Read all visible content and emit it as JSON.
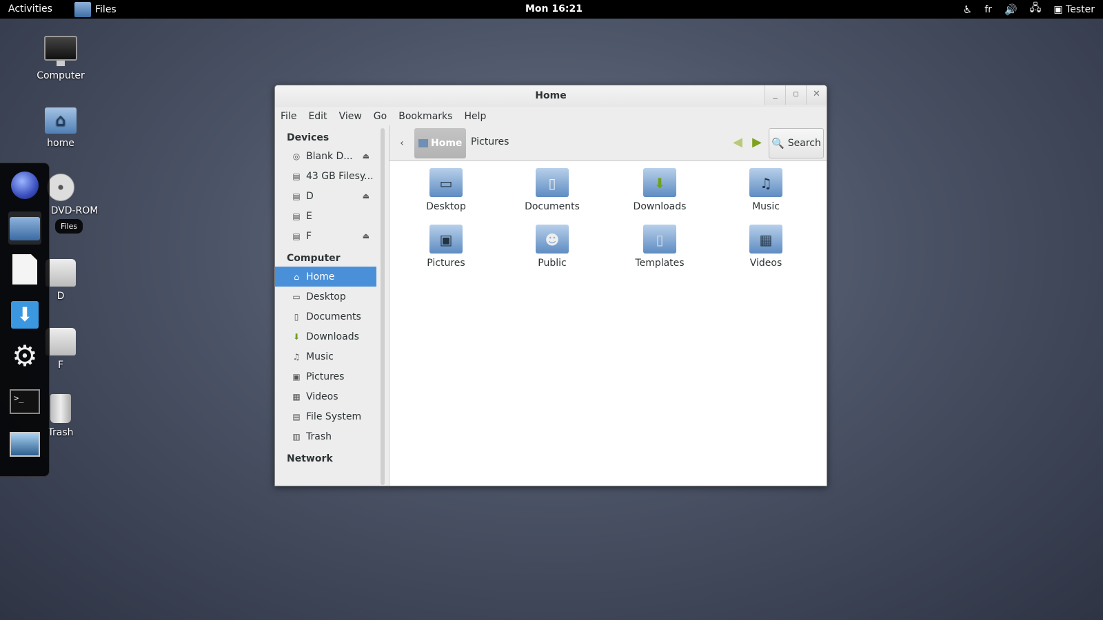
{
  "topbar": {
    "activities": "Activities",
    "app_name": "Files",
    "clock": "Mon 16:21",
    "keyboard_layout": "fr",
    "user": "Tester"
  },
  "desktop": {
    "icons": [
      {
        "label": "Computer",
        "icon": "computer-icon"
      },
      {
        "label": "home",
        "icon": "home-folder-icon"
      },
      {
        "label": "DVD-ROM",
        "icon": "disc-icon"
      },
      {
        "label": "D",
        "icon": "drive-icon"
      },
      {
        "label": "F",
        "icon": "drive-icon"
      },
      {
        "label": "Trash",
        "icon": "trash-icon"
      }
    ]
  },
  "dash": {
    "tooltip": "Files",
    "items": [
      "web-browser-icon",
      "files-icon",
      "documents-icon",
      "downloads-icon",
      "settings-icon",
      "terminal-icon",
      "screen-icon"
    ]
  },
  "window": {
    "title": "Home",
    "menu": [
      "File",
      "Edit",
      "View",
      "Go",
      "Bookmarks",
      "Help"
    ],
    "sidebar": {
      "devices_header": "Devices",
      "devices": [
        {
          "label": "Blank D...",
          "eject": true
        },
        {
          "label": "43 GB Filesy...",
          "eject": false
        },
        {
          "label": "D",
          "eject": true
        },
        {
          "label": "E",
          "eject": false
        },
        {
          "label": "F",
          "eject": true
        }
      ],
      "computer_header": "Computer",
      "computer": [
        "Home",
        "Desktop",
        "Documents",
        "Downloads",
        "Music",
        "Pictures",
        "Videos",
        "File System",
        "Trash"
      ],
      "network_header": "Network"
    },
    "pathbar": {
      "home": "Home",
      "current": "Pictures",
      "search": "Search"
    },
    "folders": [
      "Desktop",
      "Documents",
      "Downloads",
      "Music",
      "Pictures",
      "Public",
      "Templates",
      "Videos"
    ]
  }
}
